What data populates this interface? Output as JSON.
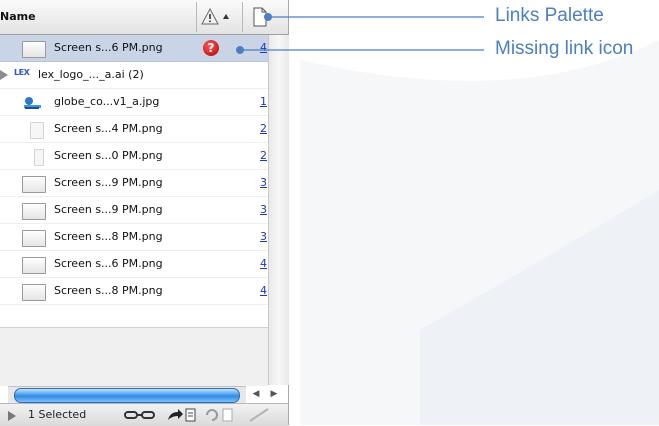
{
  "palette": {
    "header": {
      "name_label": "Name"
    },
    "rows": [
      {
        "filename": "Screen s...6 PM.png",
        "page": "4",
        "missing": true,
        "selected": true
      },
      {
        "filename": "lex_logo_..._a.ai (2)",
        "page": "",
        "group": true
      },
      {
        "filename": "globe_co...v1_a.jpg",
        "page": "1"
      },
      {
        "filename": "Screen s...4 PM.png",
        "page": "2"
      },
      {
        "filename": "Screen s...0 PM.png",
        "page": "2"
      },
      {
        "filename": "Screen s...9 PM.png",
        "page": "3"
      },
      {
        "filename": "Screen s...9 PM.png",
        "page": "3"
      },
      {
        "filename": "Screen s...8 PM.png",
        "page": "3"
      },
      {
        "filename": "Screen s...6 PM.png",
        "page": "4"
      },
      {
        "filename": "Screen s...8 PM.png",
        "page": "4"
      }
    ],
    "missing_glyph": "?",
    "group_logo_text": "LEX",
    "status": {
      "selected_label": "1 Selected"
    }
  },
  "callouts": {
    "links_palette": "Links Palette",
    "missing_link_icon": "Missing link icon"
  },
  "colors": {
    "callout": "#4b7fbf",
    "selection": "#c9d5e7",
    "missing_icon": "#c40000",
    "page_link": "#1a35c8",
    "scroll_thumb": "#2f8be6"
  }
}
